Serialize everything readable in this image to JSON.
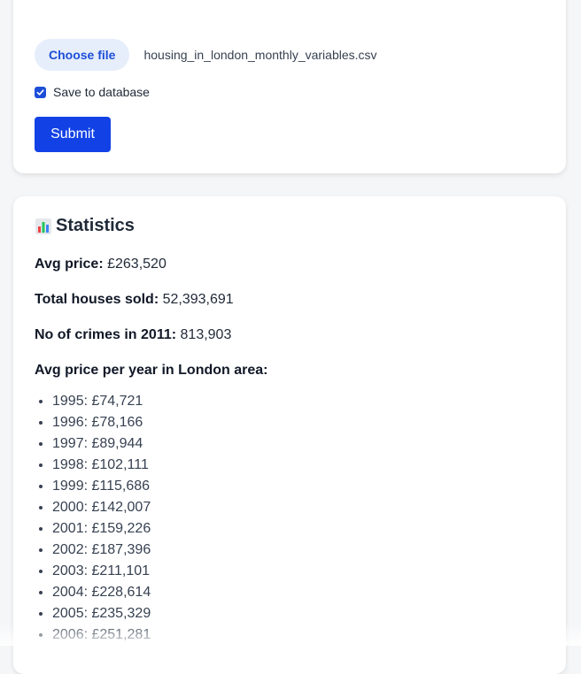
{
  "upload": {
    "choose_label": "Choose file",
    "file_name": "housing_in_london_monthly_variables.csv",
    "save_label": "Save to database",
    "save_checked": true,
    "submit_label": "Submit"
  },
  "stats": {
    "title": "Statistics",
    "avg_price_label": "Avg price:",
    "avg_price_value": "£263,520",
    "houses_sold_label": "Total houses sold:",
    "houses_sold_value": "52,393,691",
    "crimes_label": "No of crimes in 2011:",
    "crimes_value": "813,903",
    "per_year_label": "Avg price per year in London area:",
    "per_year": [
      "1995: £74,721",
      "1996: £78,166",
      "1997: £89,944",
      "1998: £102,111",
      "1999: £115,686",
      "2000: £142,007",
      "2001: £159,226",
      "2002: £187,396",
      "2003: £211,101",
      "2004: £228,614",
      "2005: £235,329",
      "2006: £251,281"
    ]
  },
  "colors": {
    "accent": "#1242e6",
    "chip_bg": "#e6eefb",
    "chip_text": "#1d4ed8"
  }
}
